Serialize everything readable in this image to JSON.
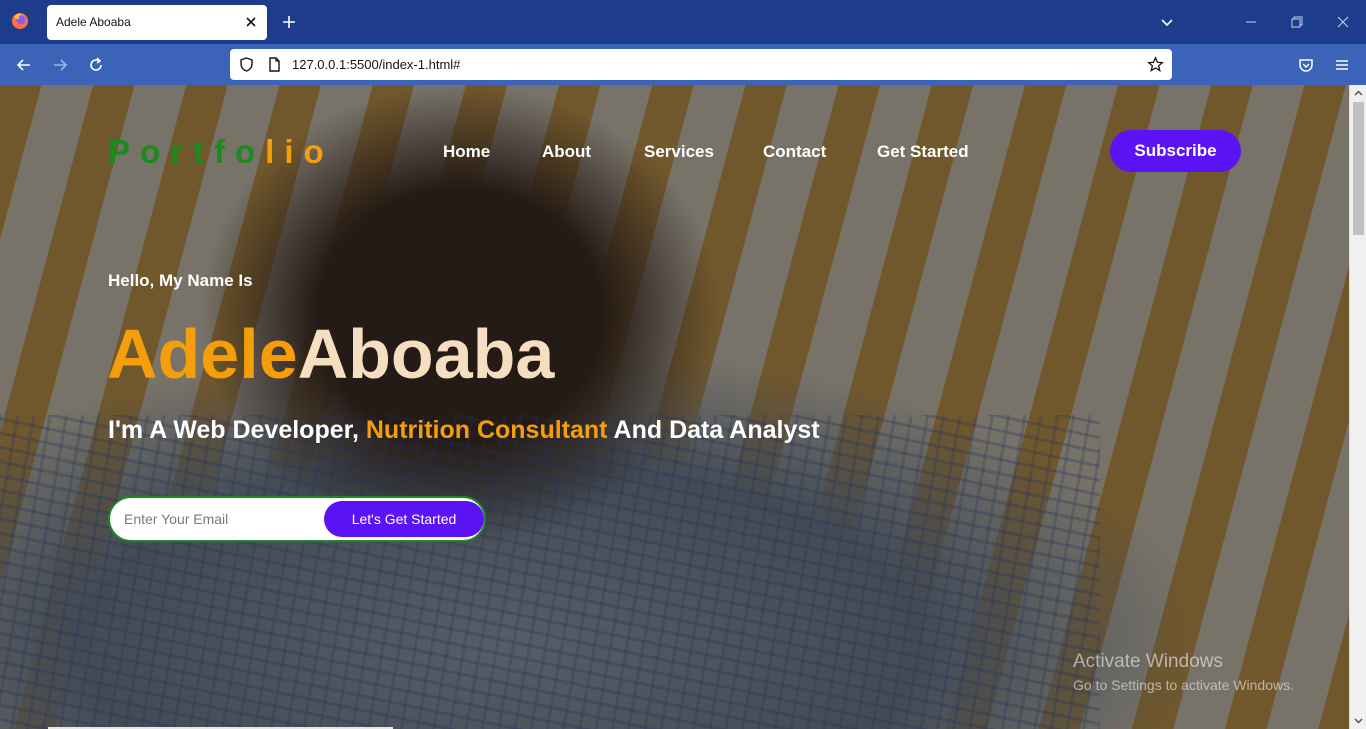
{
  "browser": {
    "tab_title": "Adele Aboaba",
    "url": "127.0.0.1:5500/index-1.html#",
    "icons": [
      "firefox-logo",
      "close-tab",
      "new-tab",
      "list-all-tabs",
      "minimize",
      "restore",
      "close-window",
      "back",
      "forward",
      "reload",
      "tracking-shield",
      "page-info",
      "bookmark-star",
      "pocket",
      "app-menu"
    ]
  },
  "site": {
    "logo_start": "Portfo",
    "logo_end": "lio",
    "menu": [
      "Home",
      "About",
      "Services",
      "Contact",
      "Get Started"
    ],
    "subscribe": "Subscribe"
  },
  "hero": {
    "greeting": "Hello, My Name Is",
    "first_name": "Adele",
    "last_name": "Aboaba",
    "tagline_a": "I'm A Web Developer, ",
    "tagline_highlight": "Nutrition Consultant",
    "tagline_b": " And Data Analyst",
    "email_placeholder": "Enter Your Email",
    "cta": "Let's Get Started"
  },
  "watermark": {
    "title": "Activate Windows",
    "subtitle": "Go to Settings to activate Windows."
  },
  "colors": {
    "accent_orange": "#f59e0b",
    "brand_green": "#1c8a1c",
    "button_purple": "#5b12f5",
    "chrome_blue": "#1d3d8c"
  }
}
